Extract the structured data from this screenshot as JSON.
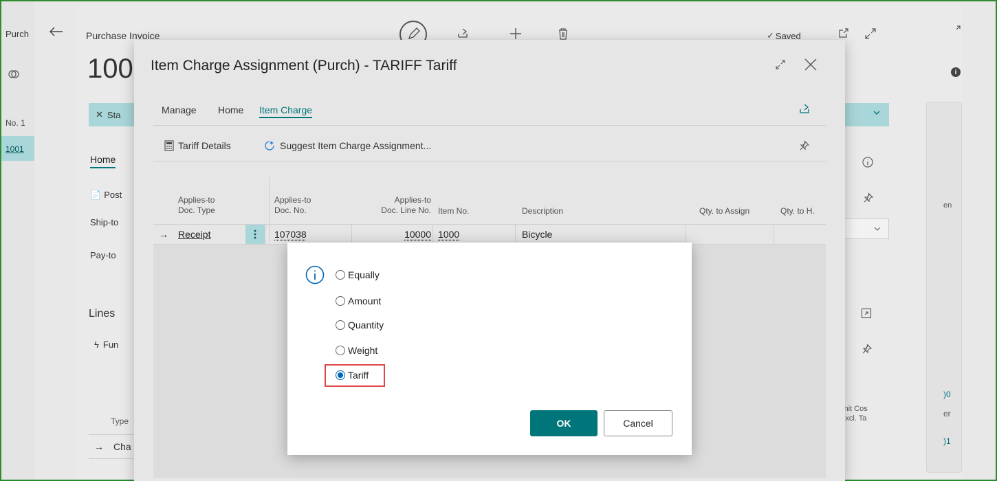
{
  "background_page": {
    "left_tab_label": "Purch",
    "left_no_label": "No. 1",
    "left_no_value": "1001",
    "title": "Purchase Invoice",
    "saved_label": "Saved",
    "doc_number_partial": "100",
    "status_partial": "Sta",
    "home_tab_partial": "Home",
    "post_partial": "Post",
    "ship_to_partial": "Ship-to",
    "pay_to_partial": "Pay-to",
    "lines_label": "Lines",
    "functions_partial": "Fun",
    "type_header": "Type",
    "line_row_partial": "Cha",
    "unit_cost_header_1": "Jnit Cos",
    "unit_cost_header_2": "Excl. Ta",
    "right_partial_1": "en",
    "right_partial_2": ")0",
    "right_partial_3": "er",
    "right_partial_4": ")1"
  },
  "modal": {
    "title": "Item Charge Assignment (Purch) - TARIFF Tariff",
    "tabs": [
      {
        "label": "Manage"
      },
      {
        "label": "Home"
      },
      {
        "label": "Item Charge"
      }
    ],
    "actions": {
      "tariff_details": "Tariff Details",
      "suggest": "Suggest Item Charge Assignment..."
    },
    "grid": {
      "headers": {
        "applies_to_doc_type_1": "Applies-to",
        "applies_to_doc_type_2": "Doc. Type",
        "applies_to_doc_no_1": "Applies-to",
        "applies_to_doc_no_2": "Doc. No.",
        "applies_to_line_1": "Applies-to",
        "applies_to_line_2": "Doc. Line No.",
        "item_no": "Item No.",
        "description": "Description",
        "qty_to_assign": "Qty. to Assign",
        "qty_to_handle": "Qty. to H."
      },
      "row": {
        "doc_type": "Receipt",
        "doc_no": "107038",
        "line_no": "10000",
        "item_no": "1000",
        "description": "Bicycle"
      }
    }
  },
  "dialog": {
    "options": [
      {
        "label": "Equally",
        "selected": false
      },
      {
        "label": "Amount",
        "selected": false
      },
      {
        "label": "Quantity",
        "selected": false
      },
      {
        "label": "Weight",
        "selected": false
      },
      {
        "label": "Tariff",
        "selected": true
      }
    ],
    "ok_label": "OK",
    "cancel_label": "Cancel"
  },
  "colors": {
    "accent": "#00757a",
    "teal_bar": "#a9d6d8",
    "highlight_box": "#e04646",
    "radio_selected": "#0067b8"
  }
}
